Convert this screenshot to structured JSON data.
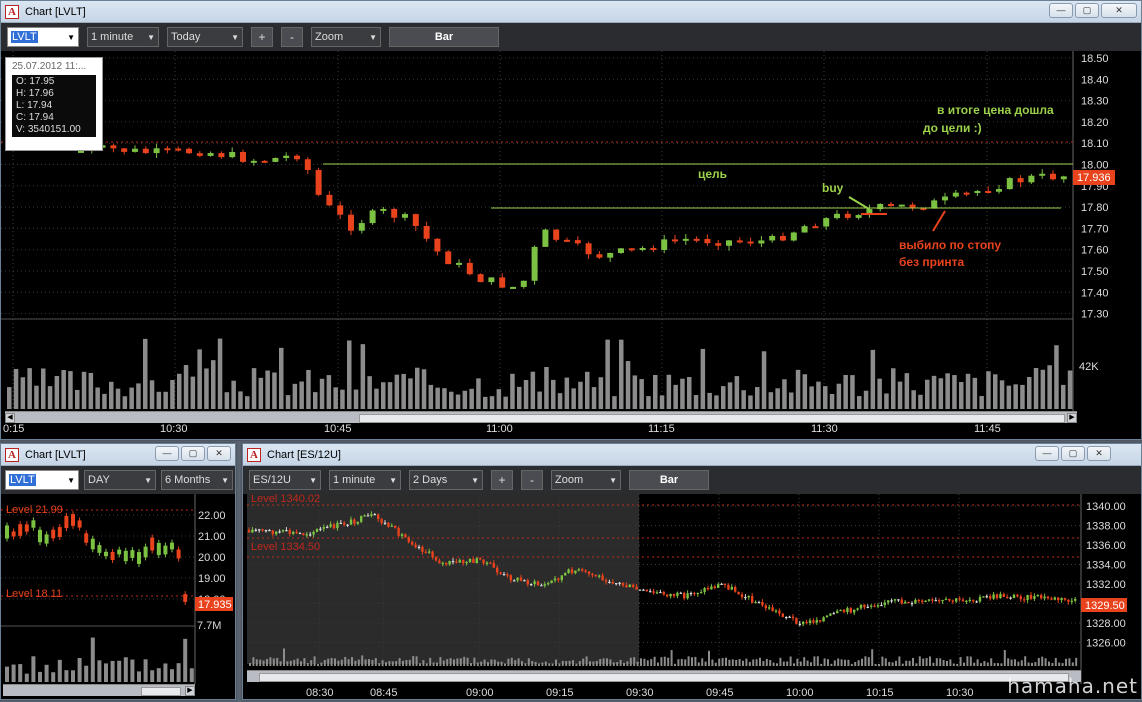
{
  "main_window": {
    "title": "Chart [LVLT]",
    "symbol": "LVLT",
    "interval": "1 minute",
    "range": "Today",
    "plus": "+",
    "minus": "-",
    "zoom": "Zoom",
    "bar": "Bar",
    "info": {
      "date": "25.07.2012 11:...",
      "open": "O: 17.95",
      "high": "H: 17.96",
      "low": "L: 17.94",
      "close": "C: 17.94",
      "volume": "V: 3540151.00"
    },
    "price_ticks": [
      "18.50",
      "18.40",
      "18.30",
      "18.20",
      "18.10",
      "18.00",
      "17.90",
      "17.80",
      "17.70",
      "17.60",
      "17.50",
      "17.40",
      "17.30"
    ],
    "last_price": "17.936",
    "volume_label": "42K",
    "time_labels": [
      "0:15",
      "10:30",
      "10:45",
      "11:00",
      "11:15",
      "11:30",
      "11:45"
    ],
    "annotations": {
      "goal_label": "цель",
      "buy_label": "buy",
      "stop_label_1": "выбило по стопу",
      "stop_label_2": "без принта",
      "summary_1": "в итоге цена дошла",
      "summary_2": "до цели :)"
    }
  },
  "left_window": {
    "title": "Chart [LVLT]",
    "symbol": "LVLT",
    "interval": "DAY",
    "range": "6 Months",
    "price_ticks": [
      "22.00",
      "21.00",
      "20.00",
      "19.00",
      "18.00"
    ],
    "last_price": "17.935",
    "volume_label": "7.7M",
    "level_1": "Level 21.99",
    "level_2": "Level 18.11"
  },
  "es_window": {
    "title": "Chart [ES/12U]",
    "symbol": "ES/12U",
    "interval": "1 minute",
    "range": "2 Days",
    "plus": "+",
    "minus": "-",
    "zoom": "Zoom",
    "bar": "Bar",
    "price_ticks": [
      "1340.00",
      "1338.00",
      "1336.00",
      "1334.00",
      "1332.00",
      "1330.00",
      "1328.00",
      "1326.00"
    ],
    "last_price": "1329.50",
    "level_1": "Level 1340.02",
    "level_2": "Level 1334.50",
    "time_labels": [
      "08:30",
      "08:45",
      "09:00",
      "09:15",
      "09:30",
      "09:45",
      "10:00",
      "10:15",
      "10:30"
    ]
  },
  "window_buttons": {
    "minimize": "—",
    "maximize": "▢",
    "close": "✕"
  },
  "watermark": "hamaha.net",
  "colors": {
    "up": "#7cc242",
    "down": "#e8431c",
    "goal_line": "#9bd14a",
    "level_line": "#c0281c",
    "background": "#000000"
  }
}
